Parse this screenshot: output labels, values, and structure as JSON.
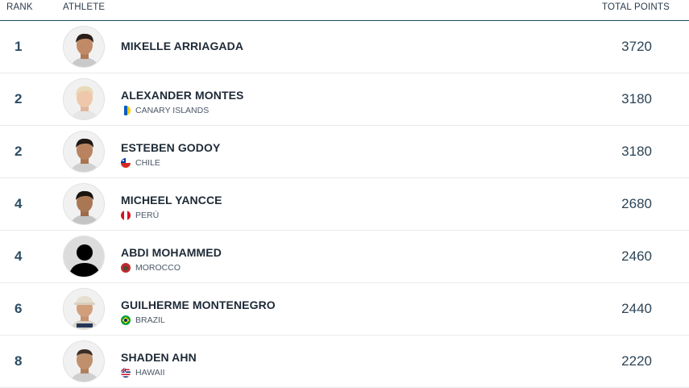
{
  "header": {
    "rank": "RANK",
    "athlete": "ATHLETE",
    "total_points": "TOTAL POINTS"
  },
  "rows": [
    {
      "rank": "1",
      "name": "MIKELLE ARRIAGADA",
      "country": "",
      "points": "3720",
      "flag": "",
      "avatar": "photo-dark-hair"
    },
    {
      "rank": "2",
      "name": "ALEXANDER MONTES",
      "country": "CANARY ISLANDS",
      "points": "3180",
      "flag": "canary-islands",
      "avatar": "photo-blond-hair"
    },
    {
      "rank": "2",
      "name": "ESTEBEN GODOY",
      "country": "CHILE",
      "points": "3180",
      "flag": "chile",
      "avatar": "photo-dark-hair"
    },
    {
      "rank": "4",
      "name": "MICHEEL YANCCE",
      "country": "PERÚ",
      "points": "2680",
      "flag": "peru",
      "avatar": "photo-dark-hair"
    },
    {
      "rank": "4",
      "name": "ABDI MOHAMMED",
      "country": "MOROCCO",
      "points": "2460",
      "flag": "morocco",
      "avatar": "placeholder-silhouette"
    },
    {
      "rank": "6",
      "name": "GUILHERME MONTENEGRO",
      "country": "BRAZIL",
      "points": "2440",
      "flag": "brazil",
      "avatar": "photo-cap"
    },
    {
      "rank": "8",
      "name": "SHADEN AHN",
      "country": "HAWAII",
      "points": "2220",
      "flag": "hawaii",
      "avatar": "photo-dark-hair"
    }
  ],
  "colors": {
    "rank": "#2d4d63",
    "divider": "#1f4a5e"
  }
}
